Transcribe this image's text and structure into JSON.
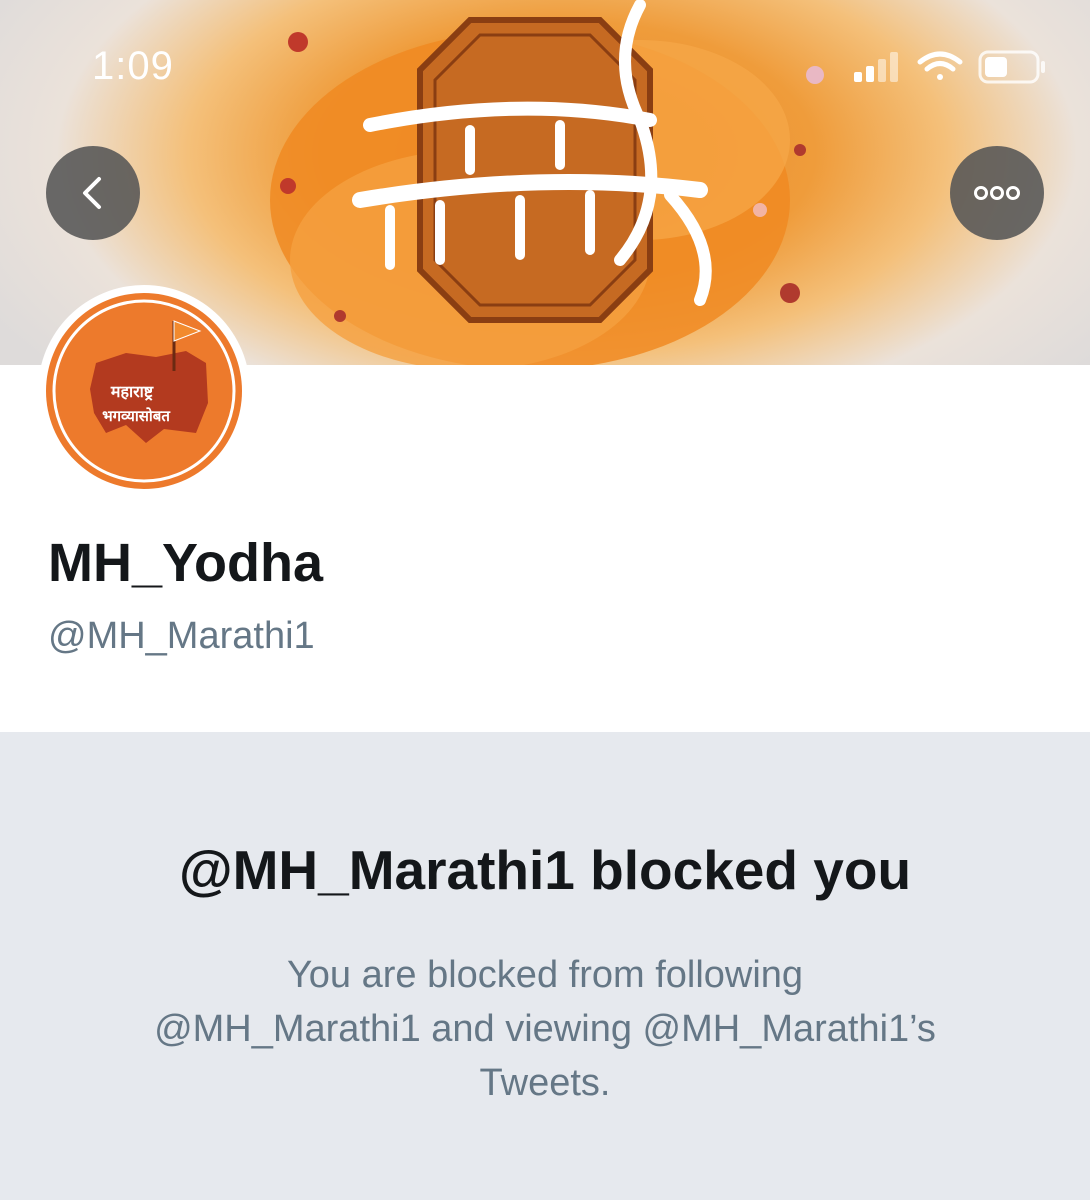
{
  "status_bar": {
    "time": "1:09"
  },
  "header": {
    "banner_image": "orange ink-splash banner with Marathi calligraphy and royal seal",
    "back_icon": "chevron-left-icon",
    "more_icon": "more-horizontal-icon"
  },
  "profile": {
    "avatar_line1": "महाराष्ट्र",
    "avatar_line2": "भगव्यासोबत",
    "display_name": "MH_Yodha",
    "handle": "@MH_Marathi1"
  },
  "blocked": {
    "title": "@MH_Marathi1 blocked you",
    "line1": "You are blocked from following",
    "line2": "@MH_Marathi1 and viewing @MH_Marathi1’s",
    "line3": "Tweets."
  },
  "colors": {
    "primary_text": "#14171a",
    "secondary_text": "#657786",
    "panel_background": "#e6e9ee",
    "banner_orange": "#ef9c3b",
    "avatar_orange": "#ed7a2c"
  }
}
